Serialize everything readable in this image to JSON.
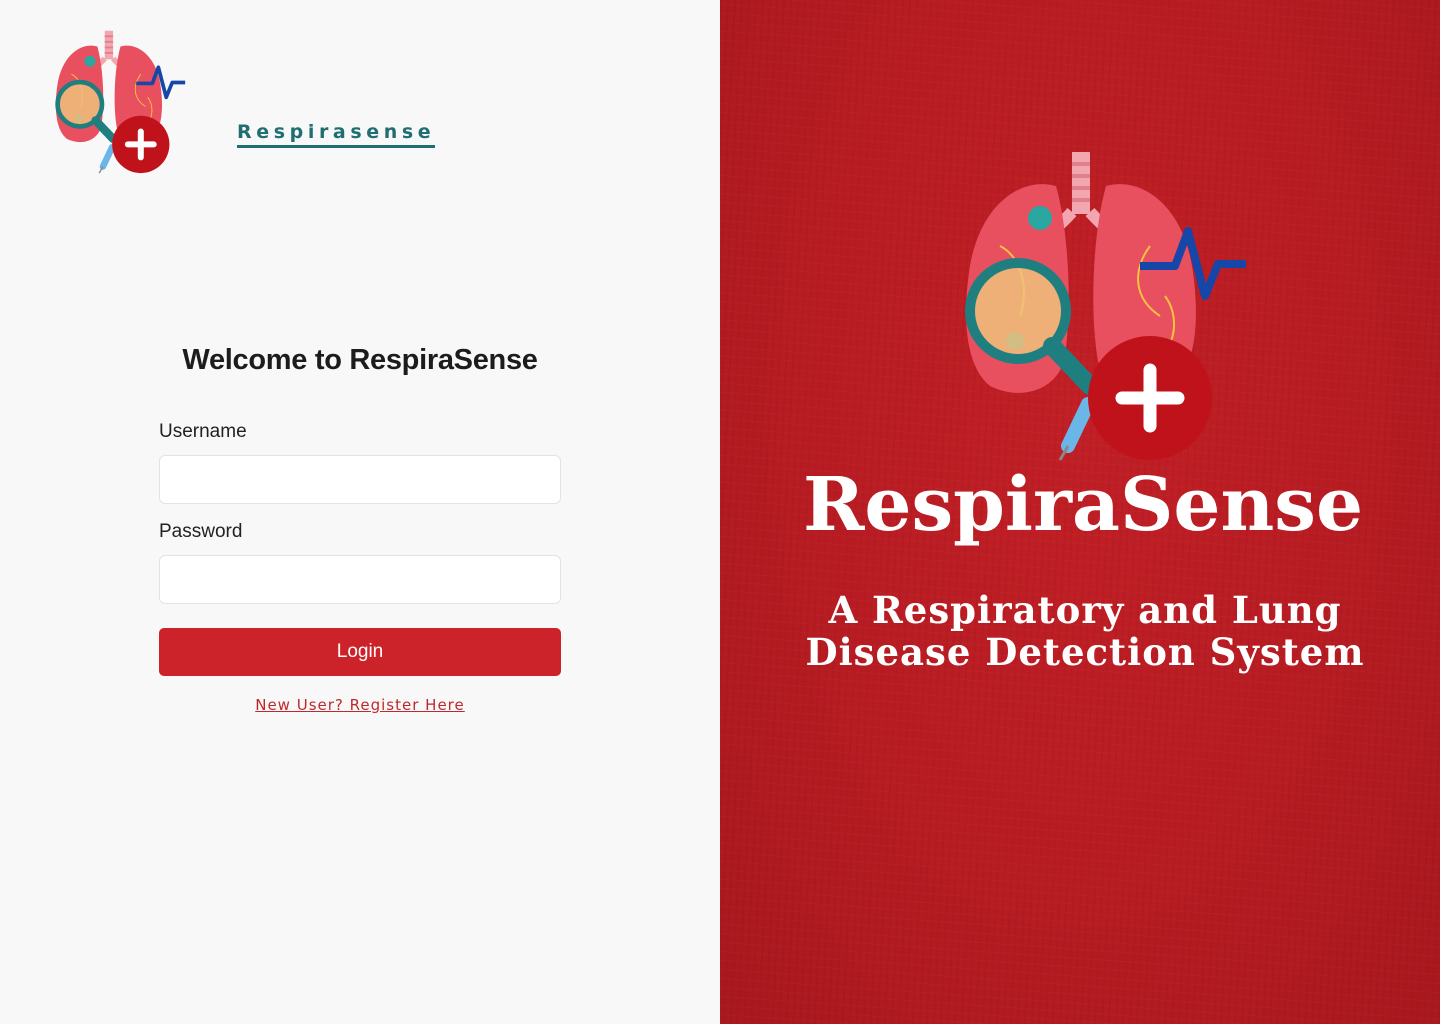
{
  "brand": {
    "name": "Respirasense"
  },
  "login": {
    "heading": "Welcome to RespiraSense",
    "username_label": "Username",
    "username_value": "",
    "password_label": "Password",
    "password_value": "",
    "login_label": "Login",
    "register_link": "New User? Register Here"
  },
  "hero": {
    "title": "RespiraSense",
    "subtitle": "A Respiratory and Lung Disease Detection System"
  },
  "colors": {
    "accent_red": "#cc2229",
    "hero_bg": "#b71c22",
    "brand_teal": "#1f6e72",
    "pulse_blue": "#1646a8"
  },
  "icons": [
    "lungs-logo-icon",
    "magnifier-icon",
    "virus-icon",
    "pulse-icon",
    "plus-icon",
    "syringe-icon"
  ]
}
